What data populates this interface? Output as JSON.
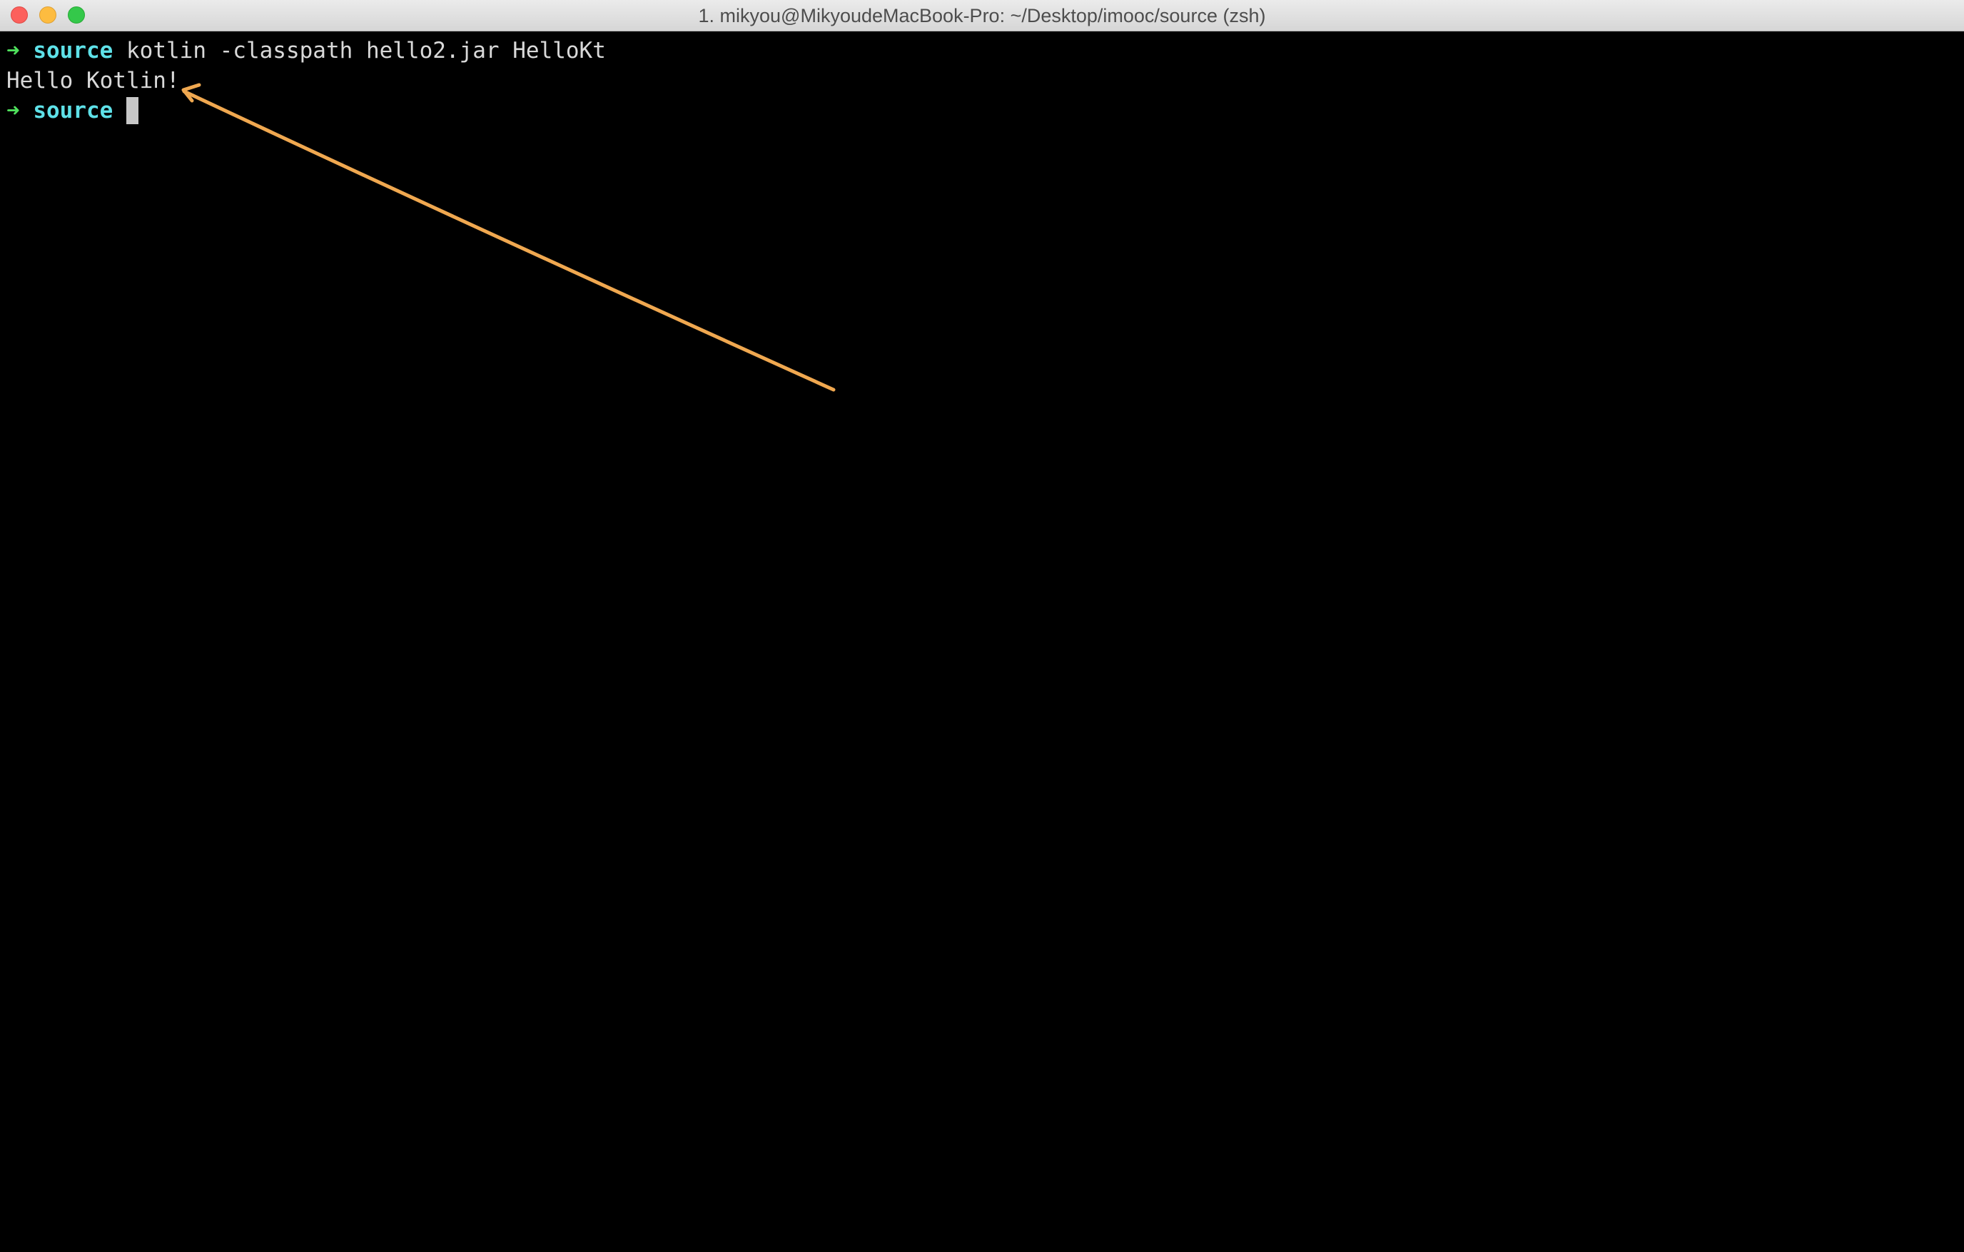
{
  "window": {
    "title": "1. mikyou@MikyoudeMacBook-Pro: ~/Desktop/imooc/source (zsh)"
  },
  "terminal": {
    "prompt_symbol": "➜",
    "directory": "source",
    "lines": [
      {
        "type": "prompt",
        "command": "kotlin -classpath hello2.jar HelloKt"
      },
      {
        "type": "output",
        "text": "Hello Kotlin!"
      },
      {
        "type": "prompt",
        "command": ""
      }
    ]
  },
  "colors": {
    "background": "#000000",
    "prompt_arrow": "#4fe05c",
    "directory": "#5ee1e8",
    "text": "#d9d9d9",
    "annotation_arrow": "#f0a850"
  }
}
